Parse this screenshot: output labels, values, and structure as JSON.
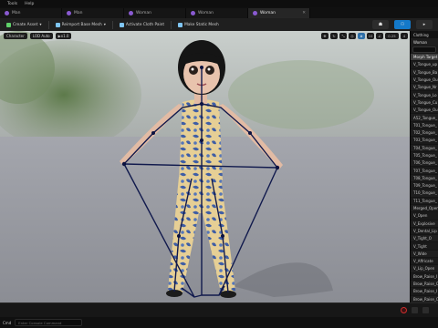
{
  "menu": {
    "items": [
      "Tools",
      "Help"
    ]
  },
  "tabs": [
    {
      "label": "Man",
      "active": false
    },
    {
      "label": "Man",
      "active": false
    },
    {
      "label": "Woman",
      "active": false
    },
    {
      "label": "Woman",
      "active": false
    },
    {
      "label": "Woman",
      "active": true
    }
  ],
  "toolbar": {
    "create_asset": "Create Asset",
    "reimport": "Reimport Base Mesh",
    "activate_cloth": "Activate Cloth Paint",
    "make_static": "Make Static Mesh"
  },
  "viewport": {
    "perspective": "Character",
    "lod": "LOD Auto",
    "speed": "x1.0",
    "right_values": [
      "10",
      "0.25",
      "4"
    ]
  },
  "panel": {
    "tab": "Clothing",
    "header": "Woman",
    "items": [
      "Morph Target",
      "V_Tongue_up",
      "V_Tongue_Ba",
      "V_Tongue_Ou",
      "V_Tongue_Nr",
      "V_Tongue_Lo",
      "V_Tongue_Cu",
      "V_Tongue_Ou",
      "A52_Tongue_",
      "T01_Tongue_",
      "T02_Tongue_",
      "T03_Tongue_",
      "T04_Tongue_",
      "T05_Tongue_",
      "T06_Tongue_",
      "T07_Tongue_",
      "T08_Tongue_",
      "T09_Tongue_",
      "T10_Tongue_",
      "T11_Tongue_",
      "Merged_Open",
      "V_Open",
      "V_Explosive",
      "V_Dental_Lip",
      "V_Tight_O",
      "V_Tight",
      "V_Wide",
      "V_Affricate",
      "V_Lip_Open",
      "Brow_Raise_I",
      "Brow_Raise_C",
      "Brow_Raise_I",
      "Brow_Raise_C",
      "Brow_Drop_L",
      "Brow_Drop_R"
    ]
  },
  "status": {
    "cmd_label": "Cmd",
    "cmd_placeholder": "Enter Console Command"
  },
  "colors": {
    "accent": "#1479c9",
    "tab_dot": "#8a5ad2",
    "record": "#cc2e2e"
  }
}
